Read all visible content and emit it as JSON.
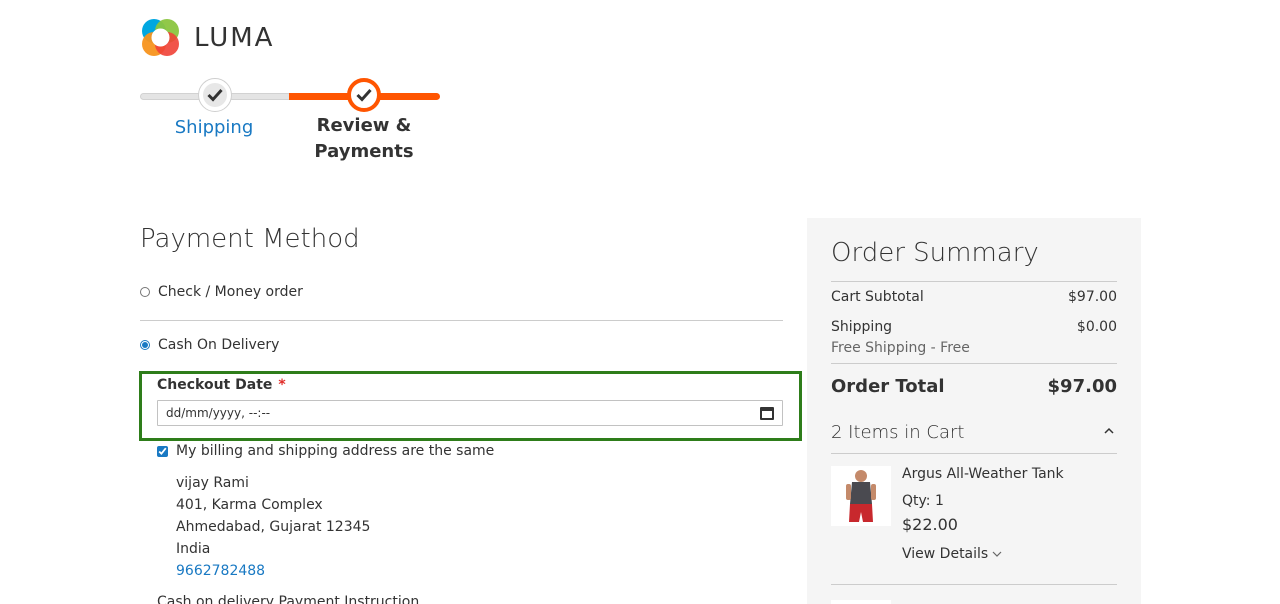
{
  "brand": {
    "name": "LUMA"
  },
  "progress": {
    "steps": [
      {
        "label": "Shipping",
        "state": "complete",
        "link": true
      },
      {
        "label": "Review & Payments",
        "state": "active",
        "link": false
      }
    ],
    "accent_color": "#ff5501"
  },
  "payment": {
    "title": "Payment Method",
    "methods": [
      {
        "label": "Check / Money order",
        "selected": false
      },
      {
        "label": "Cash On Delivery",
        "selected": true
      }
    ],
    "checkout_date": {
      "label": "Checkout Date",
      "required_mark": "*",
      "value": "dd/mm/yyyy, --:--"
    },
    "same_address": {
      "label": "My billing and shipping address are the same",
      "checked": true
    },
    "address": {
      "name": "vijay Rami",
      "street": "401, Karma Complex",
      "city_region_zip": "Ahmedabad, Gujarat 12345",
      "country": "India",
      "phone": "9662782488"
    },
    "cod_instruction_label": "Cash on delivery Payment Instruction"
  },
  "summary": {
    "title": "Order Summary",
    "cart_subtotal_label": "Cart Subtotal",
    "cart_subtotal": "$97.00",
    "shipping_label": "Shipping",
    "shipping_value": "$0.00",
    "shipping_method": "Free Shipping - Free",
    "order_total_label": "Order Total",
    "order_total": "$97.00",
    "items_in_cart": "2 Items in Cart",
    "items": [
      {
        "name": "Argus All-Weather Tank",
        "qty": "Qty: 1",
        "price": "$22.00",
        "details_label": "View Details"
      }
    ]
  },
  "colors": {
    "link": "#1979c3",
    "highlight_border": "#2e7d1a",
    "required": "#e02b27",
    "summary_bg": "#f5f5f5"
  }
}
